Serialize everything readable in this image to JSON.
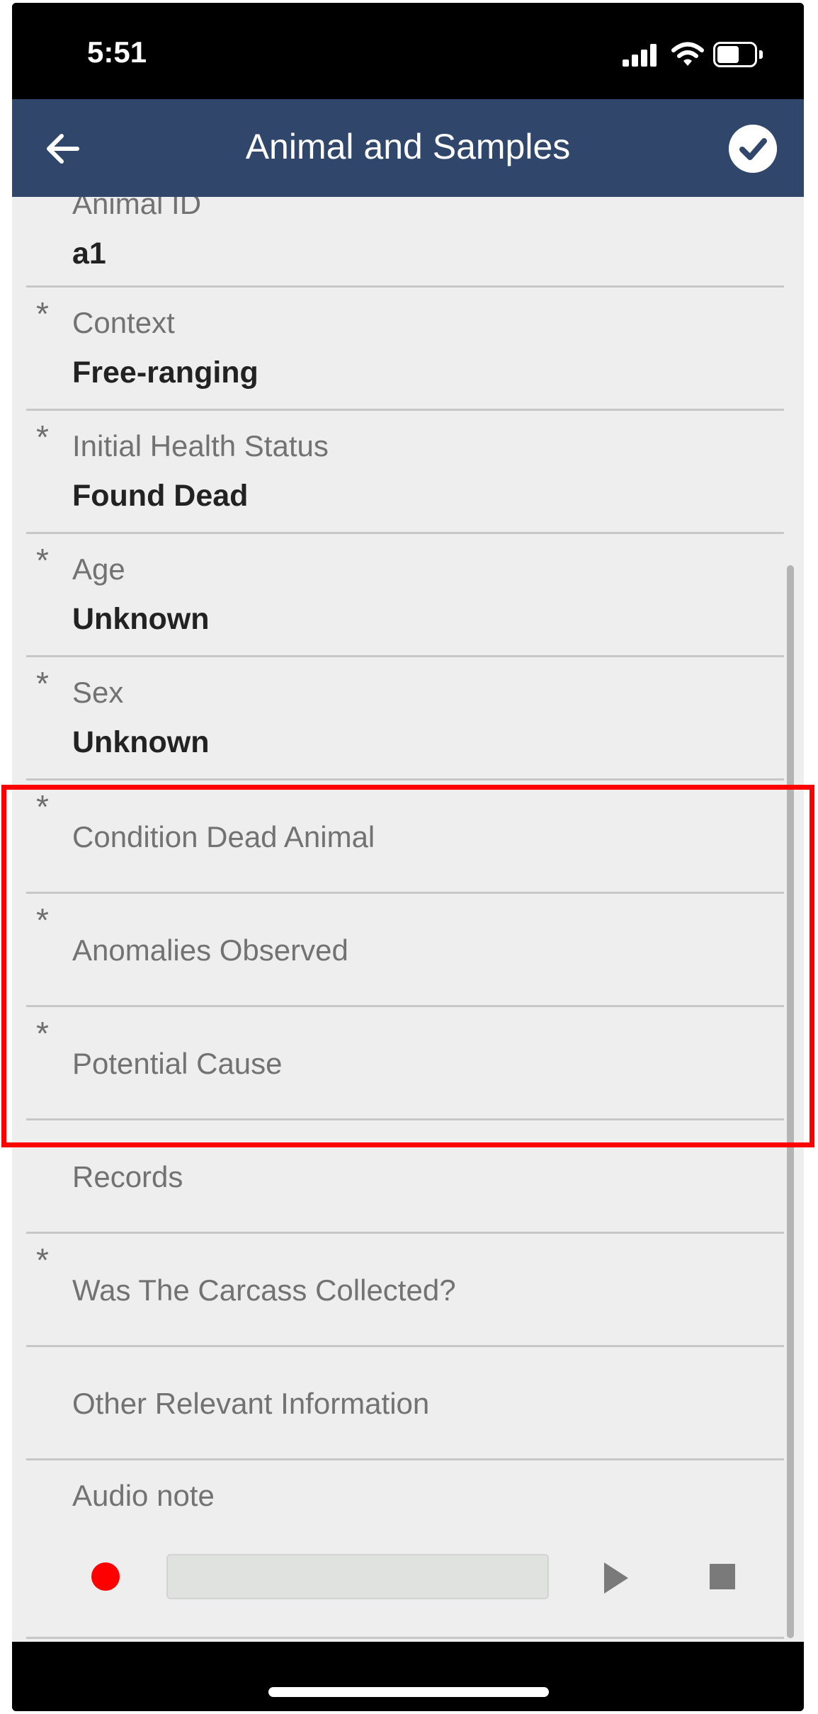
{
  "status_bar": {
    "time": "5:51"
  },
  "header": {
    "title": "Animal and Samples"
  },
  "fields": [
    {
      "label": "Animal ID",
      "value": "a1",
      "required": false
    },
    {
      "label": "Context",
      "value": "Free-ranging",
      "required": true
    },
    {
      "label": "Initial Health Status",
      "value": "Found Dead",
      "required": true
    },
    {
      "label": "Age",
      "value": "Unknown",
      "required": true
    },
    {
      "label": "Sex",
      "value": "Unknown",
      "required": true
    },
    {
      "label": "Condition Dead Animal",
      "value": "",
      "required": true
    },
    {
      "label": "Anomalies Observed",
      "value": "",
      "required": true
    },
    {
      "label": "Potential Cause",
      "value": "",
      "required": true
    },
    {
      "label": "Records",
      "value": "",
      "required": false
    },
    {
      "label": "Was The Carcass Collected?",
      "value": "",
      "required": true
    },
    {
      "label": "Other Relevant Information",
      "value": "",
      "required": false
    },
    {
      "label": "Audio note",
      "value": "",
      "required": false
    }
  ],
  "required_marker": "*",
  "colors": {
    "header": "#30466b",
    "record": "#ff0000",
    "highlight": "#ff0000"
  },
  "icons": {
    "back": "arrow-left-icon",
    "save": "check-circle-icon",
    "record": "record-icon",
    "play": "play-icon",
    "stop": "stop-icon"
  }
}
